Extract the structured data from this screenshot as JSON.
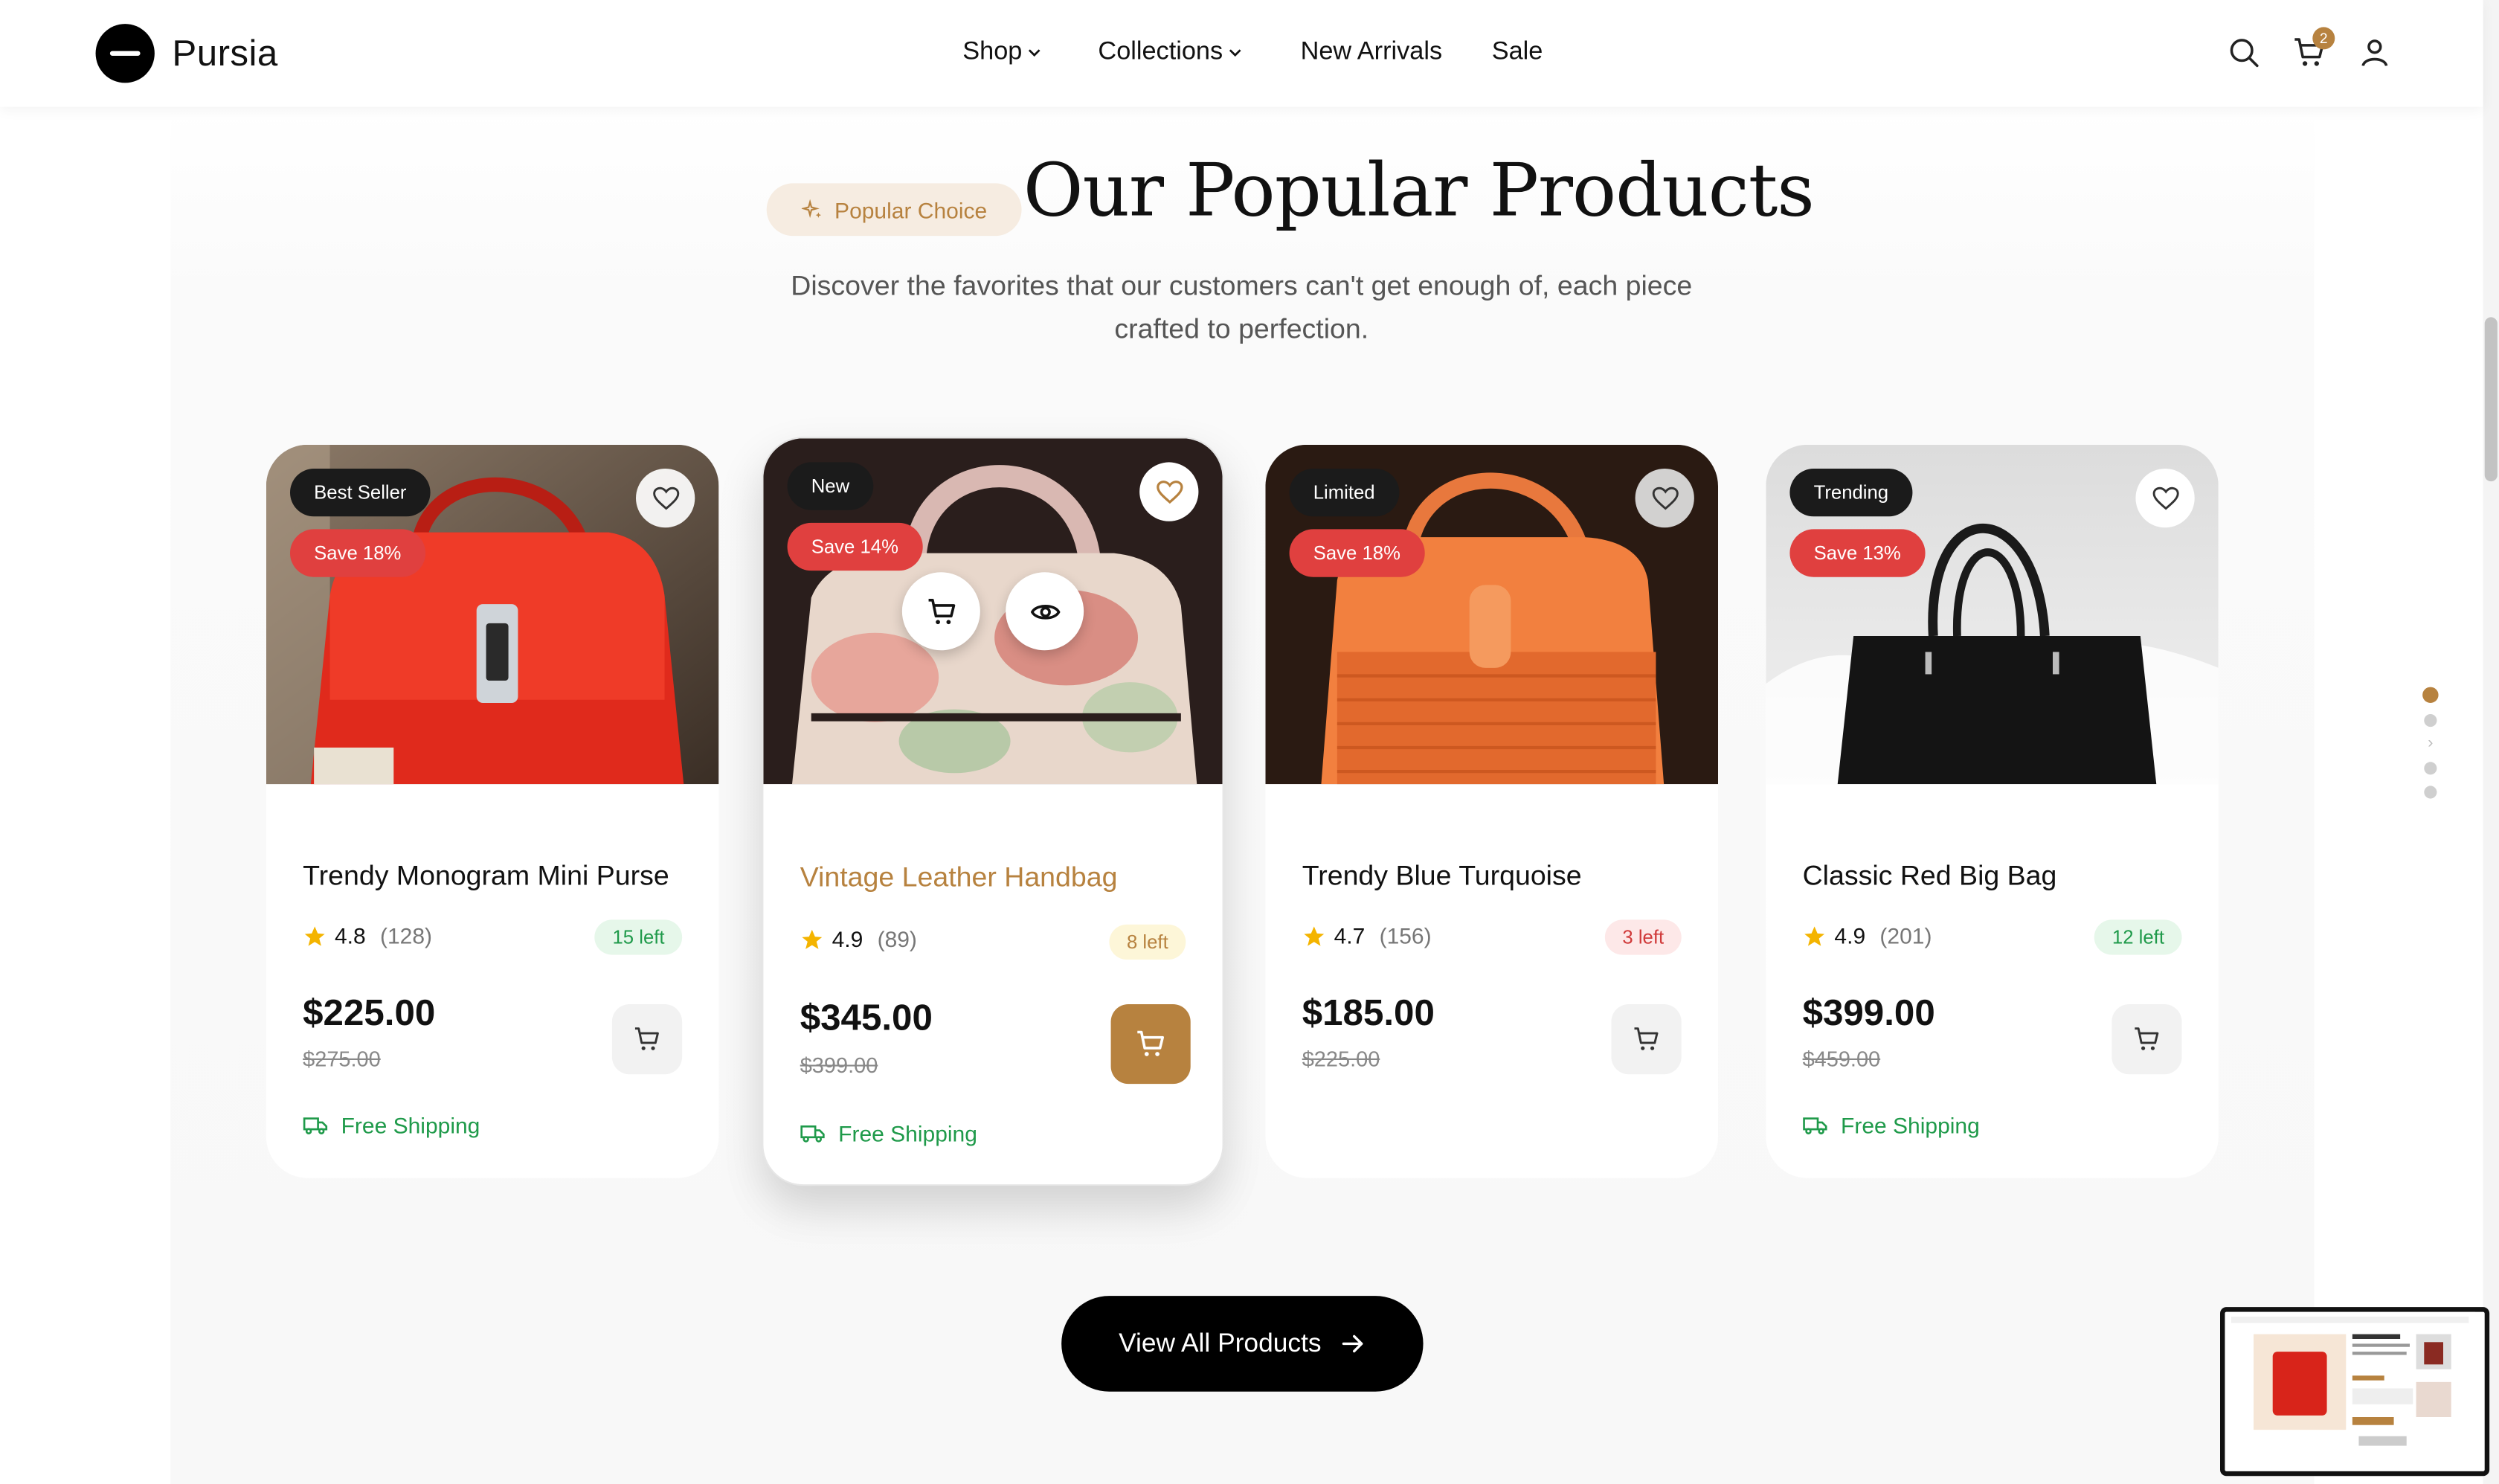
{
  "brand": {
    "name": "Pursia"
  },
  "nav": {
    "items": [
      {
        "label": "Shop",
        "dropdown": true
      },
      {
        "label": "Collections",
        "dropdown": true
      },
      {
        "label": "New Arrivals",
        "dropdown": false
      },
      {
        "label": "Sale",
        "dropdown": false
      }
    ]
  },
  "header_icons": {
    "search": "search-icon",
    "cart": "cart-icon",
    "account": "user-icon",
    "cart_count": "2"
  },
  "section": {
    "pill": "Popular Choice",
    "title": "Our Popular Products",
    "subtitle": "Discover the favorites that our customers can't get enough of, each piece crafted to perfection."
  },
  "products": [
    {
      "tag": "Best Seller",
      "save": "Save 18%",
      "name": "Trendy Monogram Mini Purse",
      "rating": "4.8",
      "reviews": "(128)",
      "stock": "15 left",
      "stock_level": "green",
      "price": "$225.00",
      "old_price": "$275.00",
      "shipping": "Free Shipping"
    },
    {
      "tag": "New",
      "save": "Save 14%",
      "name": "Vintage Leather Handbag",
      "rating": "4.9",
      "reviews": "(89)",
      "stock": "8 left",
      "stock_level": "yellow",
      "price": "$345.00",
      "old_price": "$399.00",
      "shipping": "Free Shipping"
    },
    {
      "tag": "Limited",
      "save": "Save 18%",
      "name": "Trendy Blue Turquoise",
      "rating": "4.7",
      "reviews": "(156)",
      "stock": "3 left",
      "stock_level": "red",
      "price": "$185.00",
      "old_price": "$225.00",
      "shipping": ""
    },
    {
      "tag": "Trending",
      "save": "Save 13%",
      "name": "Classic Red Big Bag",
      "rating": "4.9",
      "reviews": "(201)",
      "stock": "12 left",
      "stock_level": "green",
      "price": "$399.00",
      "old_price": "$459.00",
      "shipping": "Free Shipping"
    }
  ],
  "cta": {
    "label": "View All Products"
  },
  "colors": {
    "accent": "#b7823f",
    "sale": "#e0403f",
    "success": "#1f9a4a",
    "dark": "#000000"
  }
}
